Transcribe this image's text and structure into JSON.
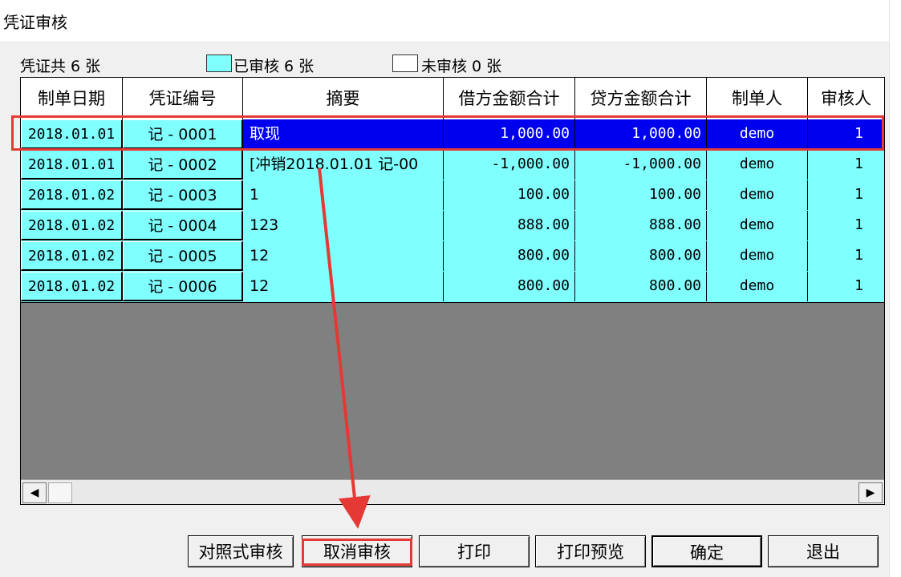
{
  "window": {
    "title": "凭证审核"
  },
  "summary": {
    "total": "凭证共 6 张",
    "audited": "已审核 6 张",
    "unaudited": "未审核 0 张"
  },
  "colors": {
    "audited_row": "#80ffff",
    "selected_row": "#0000ee",
    "annotation": "#e53935"
  },
  "table": {
    "columns": [
      "制单日期",
      "凭证编号",
      "摘要",
      "借方金额合计",
      "贷方金额合计",
      "制单人",
      "审核人"
    ],
    "rows": [
      {
        "date": "2018.01.01",
        "no": "记 - 0001",
        "summary": "取现",
        "debit": "1,000.00",
        "credit": "1,000.00",
        "maker": "demo",
        "auditor": "1"
      },
      {
        "date": "2018.01.01",
        "no": "记 - 0002",
        "summary": "[冲销2018.01.01 记-00",
        "debit": "-1,000.00",
        "credit": "-1,000.00",
        "maker": "demo",
        "auditor": "1"
      },
      {
        "date": "2018.01.02",
        "no": "记 - 0003",
        "summary": "1",
        "debit": "100.00",
        "credit": "100.00",
        "maker": "demo",
        "auditor": "1"
      },
      {
        "date": "2018.01.02",
        "no": "记 - 0004",
        "summary": "123",
        "debit": "888.00",
        "credit": "888.00",
        "maker": "demo",
        "auditor": "1"
      },
      {
        "date": "2018.01.02",
        "no": "记 - 0005",
        "summary": "12",
        "debit": "800.00",
        "credit": "800.00",
        "maker": "demo",
        "auditor": "1"
      },
      {
        "date": "2018.01.02",
        "no": "记 - 0006",
        "summary": "12",
        "debit": "800.00",
        "credit": "800.00",
        "maker": "demo",
        "auditor": "1"
      }
    ]
  },
  "scrollbar": {
    "left_icon": "◀",
    "right_icon": "▶"
  },
  "buttons": {
    "compare": "对照式审核",
    "cancel_audit": "取消审核",
    "print": "打印",
    "print_preview": "打印预览",
    "ok": "确定",
    "exit": "退出"
  }
}
